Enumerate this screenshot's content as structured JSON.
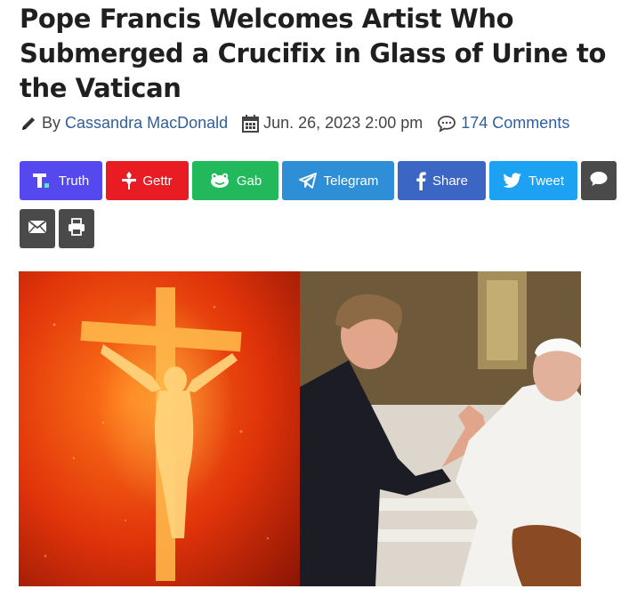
{
  "article": {
    "title": "Pope Francis Welcomes Artist Who Submerged a Crucifix in Glass of Urine to the Vatican",
    "by_label": "By",
    "author": "Cassandra MacDonald",
    "date": "Jun. 26, 2023 2:00 pm",
    "comments": "174 Comments"
  },
  "share_buttons": [
    {
      "label": "Truth",
      "color": "#5448ee",
      "icon": "truth-social-icon"
    },
    {
      "label": "Gettr",
      "color": "#e91c24",
      "icon": "gettr-icon"
    },
    {
      "label": "Gab",
      "color": "#21b95c",
      "icon": "gab-icon"
    },
    {
      "label": "Telegram",
      "color": "#2f8fd6",
      "icon": "telegram-icon"
    },
    {
      "label": "Share",
      "color": "#3b66c4",
      "icon": "facebook-icon"
    },
    {
      "label": "Tweet",
      "color": "#1da1f2",
      "icon": "twitter-icon"
    }
  ],
  "extra_buttons": [
    {
      "icon": "comment-bubble-icon",
      "color": "#4a4a4a"
    },
    {
      "icon": "email-icon",
      "color": "#4a4a4a"
    },
    {
      "icon": "print-icon",
      "color": "#4a4a4a"
    }
  ],
  "image": {
    "left_panel": "crucifix-in-orange-liquid",
    "right_panel": "pope-shaking-hands-with-artist"
  }
}
